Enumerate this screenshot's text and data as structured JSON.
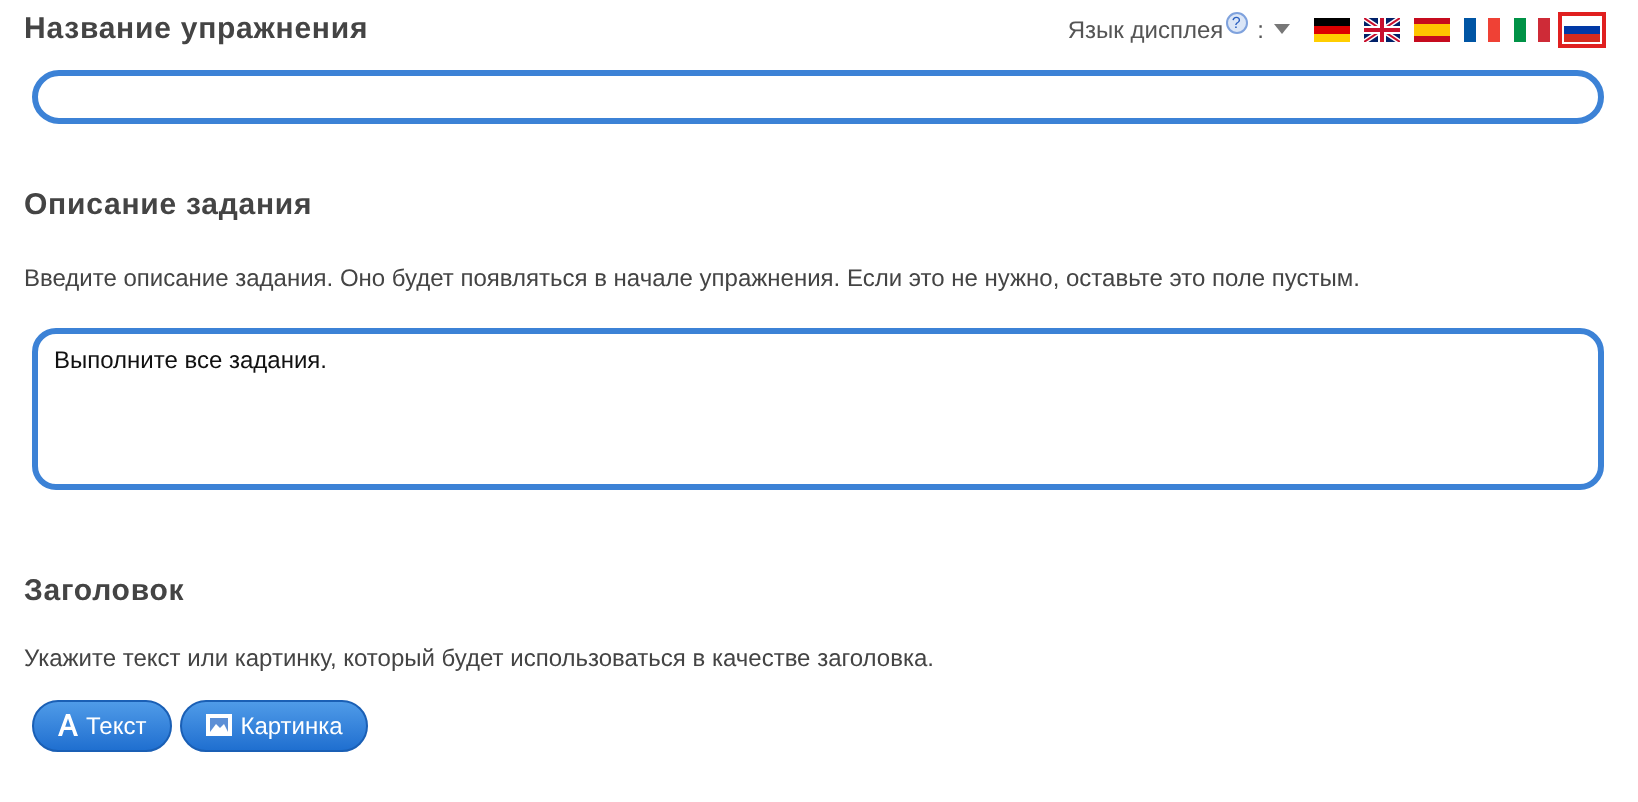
{
  "title_section": {
    "heading": "Название упражнения",
    "display_language": {
      "label": "Язык дисплея",
      "help": "?",
      "colon": ":",
      "flags": [
        {
          "kind": "de",
          "selected": false
        },
        {
          "kind": "gb",
          "selected": false
        },
        {
          "kind": "es",
          "selected": false
        },
        {
          "kind": "fr",
          "selected": false
        },
        {
          "kind": "it",
          "selected": false
        },
        {
          "kind": "ru",
          "selected": true
        }
      ]
    }
  },
  "description_section": {
    "heading": "Описание задания",
    "hint": "Введите описание задания. Оно будет появляться в начале упражнения. Если это не нужно, оставьте это поле пустым.",
    "value": "Выполните все задания."
  },
  "header_section": {
    "heading": "Заголовок",
    "hint": "Укажите текст или картинку, который будет использоваться в качестве заголовка.",
    "buttons": [
      {
        "kind": "text",
        "label": "Текст"
      },
      {
        "kind": "image",
        "label": "Картинка"
      }
    ]
  }
}
